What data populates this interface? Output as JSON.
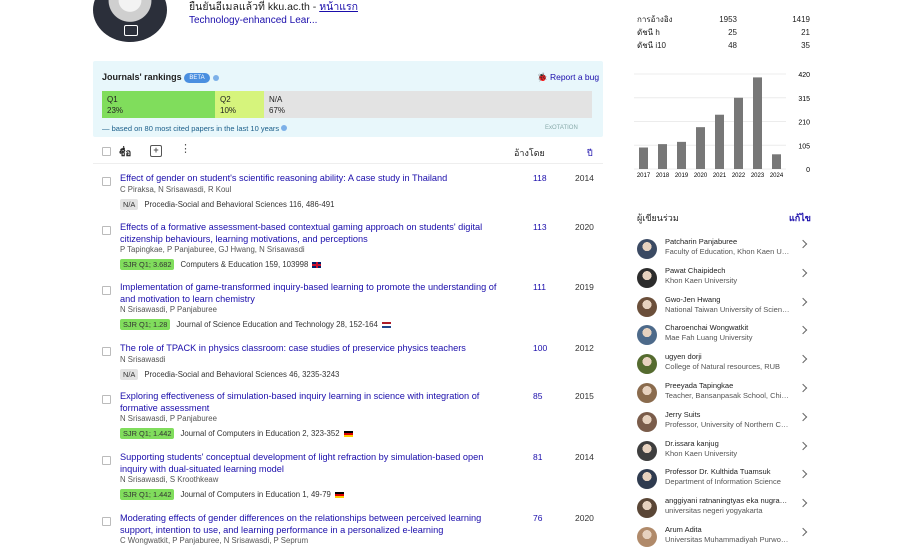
{
  "profile": {
    "verified_email": "ยืนยันอีเมลแล้วที่ kku.ac.th",
    "sep": " - ",
    "homepage": "หน้าแรก",
    "interest": "Technology-enhanced Lear..."
  },
  "rankings": {
    "title": "Journals' rankings",
    "beta": "BETA",
    "report": "Report a bug",
    "segments": [
      {
        "label": "Q1",
        "pct": "23%",
        "fraction": 0.23,
        "color": "#80dd5c"
      },
      {
        "label": "Q2",
        "pct": "10%",
        "fraction": 0.1,
        "color": "#d6f47c"
      },
      {
        "label": "N/A",
        "pct": "67%",
        "fraction": 0.67,
        "color": "#e3e3e3"
      }
    ],
    "based_on": "— based on 80 most cited papers in the last 10 years",
    "exo": "ExOTATION"
  },
  "table_header": {
    "name": "ชื่อ",
    "cited_by": "อ้างโดย",
    "year": "ปี"
  },
  "articles": [
    {
      "title": "Effect of gender on student's scientific reasoning ability: A case study in Thailand",
      "authors": "C Piraksa, N Srisawasdi, R Koul",
      "badge": "N/A",
      "venue": "Procedia-Social and Behavioral Sciences 116, 486-491",
      "flag": "",
      "cited": "118",
      "year": "2014"
    },
    {
      "title": "Effects of a formative assessment-based contextual gaming approach on students' digital citizenship behaviours, learning motivations, and perceptions",
      "authors": "P Tapingkae, P Panjaburee, GJ Hwang, N Srisawasdi",
      "badge": "SJR Q1; 3.682",
      "venue": "Computers & Education 159, 103998",
      "flag": "uk",
      "cited": "113",
      "year": "2020"
    },
    {
      "title": "Implementation of game-transformed inquiry-based learning to promote the understanding of and motivation to learn chemistry",
      "authors": "N Srisawasdi, P Panjaburee",
      "badge": "SJR Q1; 1.28",
      "venue": "Journal of Science Education and Technology 28, 152-164",
      "flag": "nl",
      "cited": "111",
      "year": "2019"
    },
    {
      "title": "The role of TPACK in physics classroom: case studies of preservice physics teachers",
      "authors": "N Srisawasdi",
      "badge": "N/A",
      "venue": "Procedia-Social and Behavioral Sciences 46, 3235-3243",
      "flag": "",
      "cited": "100",
      "year": "2012"
    },
    {
      "title": "Exploring effectiveness of simulation-based inquiry learning in science with integration of formative assessment",
      "authors": "N Srisawasdi, P Panjaburee",
      "badge": "SJR Q1; 1.442",
      "venue": "Journal of Computers in Education 2, 323-352",
      "flag": "de",
      "cited": "85",
      "year": "2015"
    },
    {
      "title": "Supporting students' conceptual development of light refraction by simulation-based open inquiry with dual-situated learning model",
      "authors": "N Srisawasdi, S Kroothkeaw",
      "badge": "SJR Q1; 1.442",
      "venue": "Journal of Computers in Education 1, 49-79",
      "flag": "de",
      "cited": "81",
      "year": "2014"
    },
    {
      "title": "Moderating effects of gender differences on the relationships between perceived learning support, intention to use, and learning performance in a personalized e-learning",
      "authors": "C Wongwatkit, P Panjaburee, N Srisawasdi, P Seprum",
      "badge": "",
      "venue": "",
      "flag": "",
      "cited": "76",
      "year": "2020"
    }
  ],
  "metrics": [
    {
      "label": "การอ้างอิง",
      "all": "1953",
      "since": "1419"
    },
    {
      "label": "ดัชนี h",
      "all": "25",
      "since": "21"
    },
    {
      "label": "ดัชนี i10",
      "all": "48",
      "since": "35"
    }
  ],
  "chart_data": {
    "type": "bar",
    "categories": [
      "2017",
      "2018",
      "2019",
      "2020",
      "2021",
      "2022",
      "2023",
      "2024"
    ],
    "values": [
      95,
      110,
      120,
      185,
      240,
      315,
      405,
      65
    ],
    "yticks": [
      "420",
      "315",
      "210",
      "105",
      "0"
    ],
    "ylim": [
      0,
      420
    ]
  },
  "coauthors": {
    "heading": "ผู้เขียนร่วม",
    "edit": "แก้ไข",
    "list": [
      {
        "name": "Patcharin Panjaburee",
        "aff": "Faculty of Education, Khon Kaen University"
      },
      {
        "name": "Pawat Chaipidech",
        "aff": "Khon Kaen University"
      },
      {
        "name": "Gwo-Jen Hwang",
        "aff": "National Taiwan University of Science and Technology"
      },
      {
        "name": "Charoenchai Wongwatkit",
        "aff": "Mae Fah Luang University"
      },
      {
        "name": "ugyen dorji",
        "aff": "College of Natural resources, RUB"
      },
      {
        "name": "Preeyada Tapingkae",
        "aff": "Teacher, Bansanpasak School, Chiang Mai"
      },
      {
        "name": "Jerry Suits",
        "aff": "Professor, University of Northern Colorado"
      },
      {
        "name": "Dr.issara kanjug",
        "aff": "Khon Kaen University"
      },
      {
        "name": "Professor Dr. Kulthida Tuamsuk",
        "aff": "Department of Information Science"
      },
      {
        "name": "anggiyani ratnaningtyas eka nugraheni",
        "aff": "universitas negeri yogyakarta"
      },
      {
        "name": "Arum Adita",
        "aff": "Universitas Muhammadiyah Purwokerto"
      }
    ]
  }
}
